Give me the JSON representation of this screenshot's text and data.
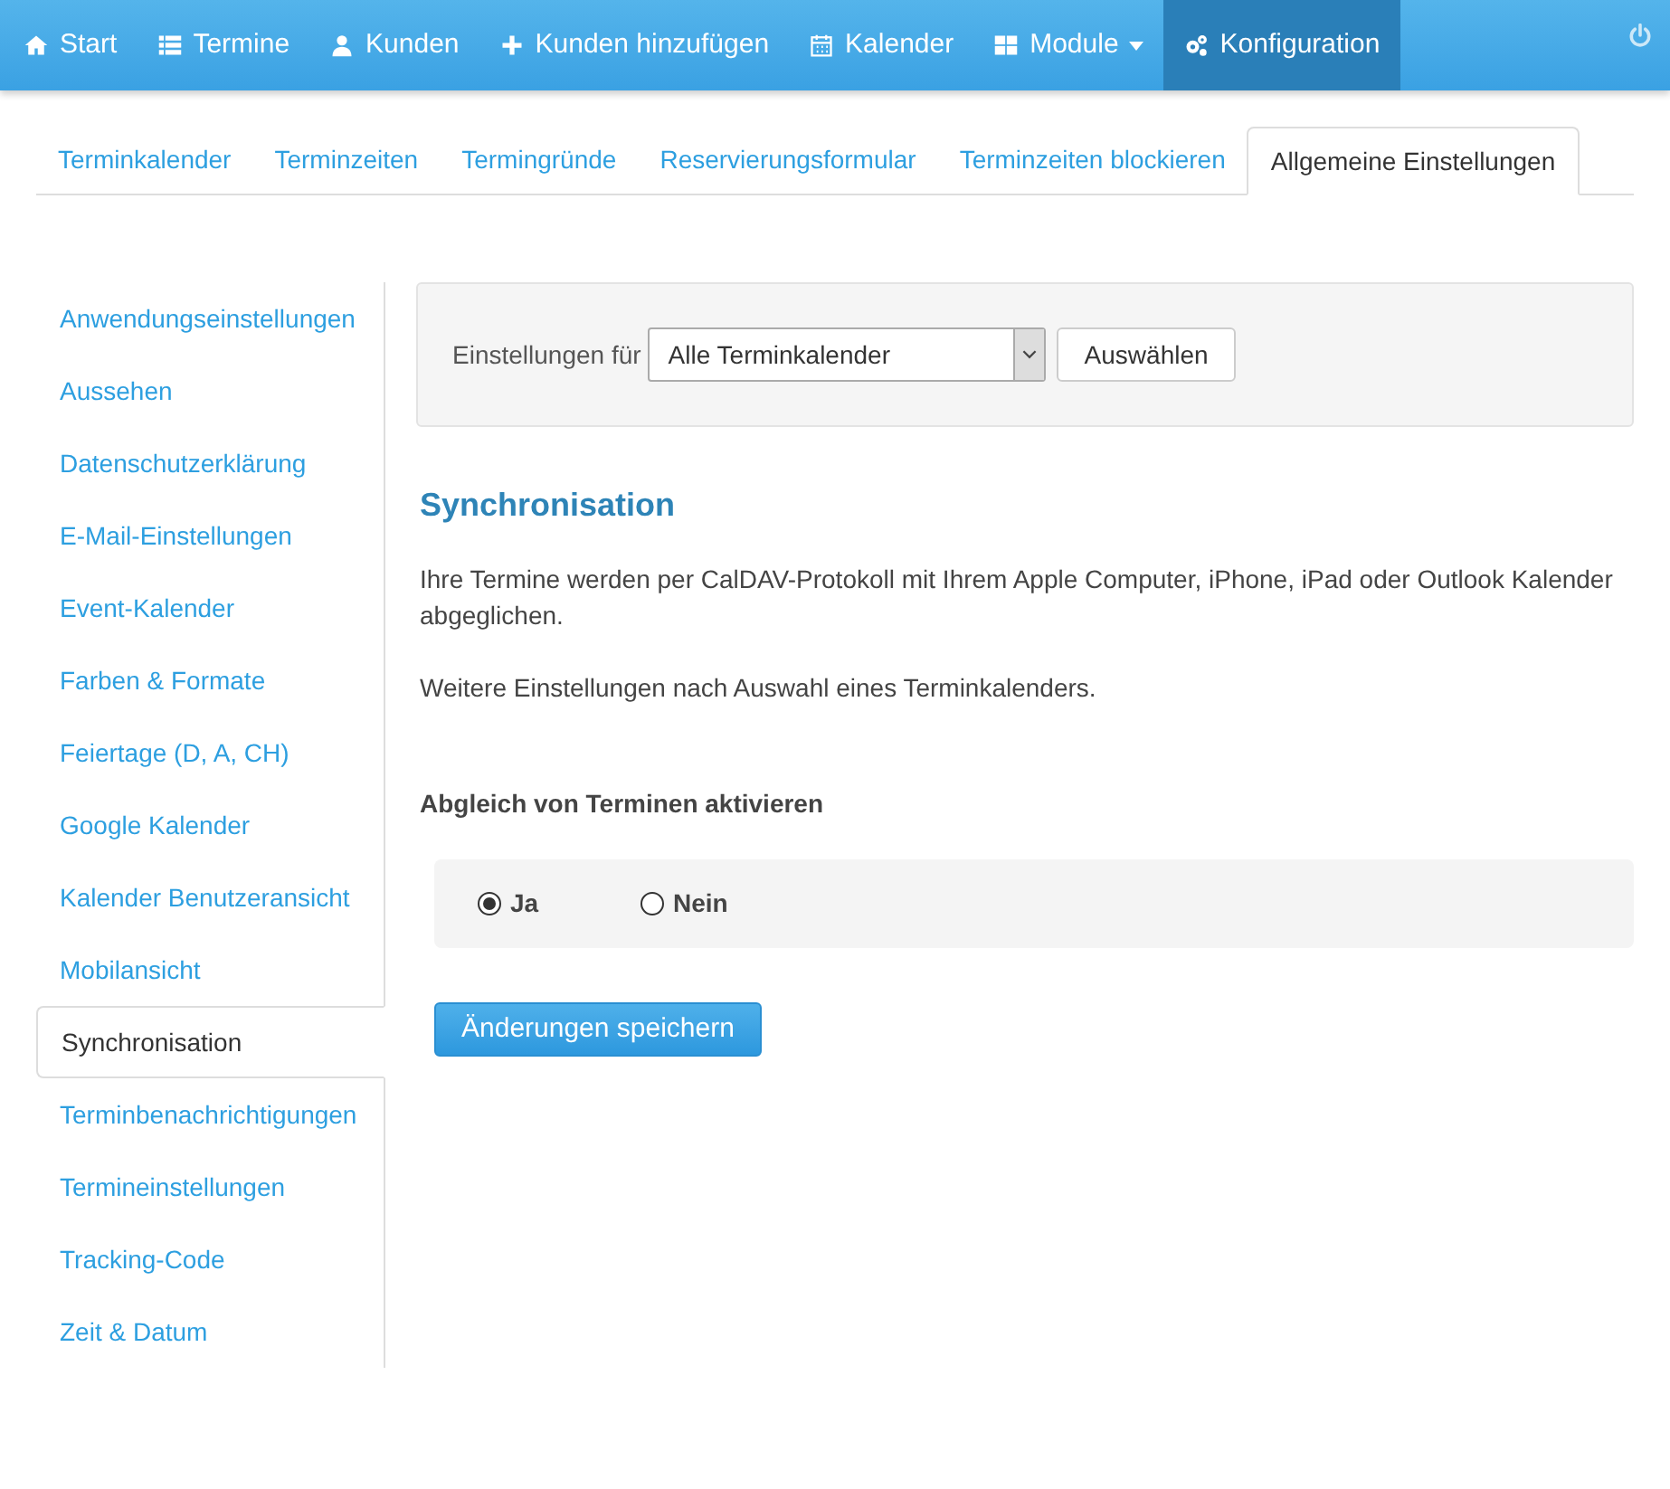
{
  "navbar": {
    "items": [
      {
        "label": "Start",
        "selected": false
      },
      {
        "label": "Termine",
        "selected": false
      },
      {
        "label": "Kunden",
        "selected": false
      },
      {
        "label": "Kunden hinzufügen",
        "selected": false
      },
      {
        "label": "Kalender",
        "selected": false
      },
      {
        "label": "Module",
        "selected": false,
        "dropdown": true
      },
      {
        "label": "Konfiguration",
        "selected": true
      }
    ]
  },
  "tabs": [
    {
      "label": "Terminkalender",
      "selected": false
    },
    {
      "label": "Terminzeiten",
      "selected": false
    },
    {
      "label": "Termingründe",
      "selected": false
    },
    {
      "label": "Reservierungsformular",
      "selected": false
    },
    {
      "label": "Terminzeiten blockieren",
      "selected": false
    },
    {
      "label": "Allgemeine Einstellungen",
      "selected": true
    }
  ],
  "sidebar": {
    "items": [
      {
        "label": "Anwendungseinstellungen",
        "selected": false
      },
      {
        "label": "Aussehen",
        "selected": false
      },
      {
        "label": "Datenschutzerklärung",
        "selected": false
      },
      {
        "label": "E-Mail-Einstellungen",
        "selected": false
      },
      {
        "label": "Event-Kalender",
        "selected": false
      },
      {
        "label": "Farben & Formate",
        "selected": false
      },
      {
        "label": "Feiertage (D, A, CH)",
        "selected": false
      },
      {
        "label": "Google Kalender",
        "selected": false
      },
      {
        "label": "Kalender Benutzeransicht",
        "selected": false
      },
      {
        "label": "Mobilansicht",
        "selected": false
      },
      {
        "label": "Synchronisation",
        "selected": true
      },
      {
        "label": "Terminbenachrichtigungen",
        "selected": false
      },
      {
        "label": "Termineinstellungen",
        "selected": false
      },
      {
        "label": "Tracking-Code",
        "selected": false
      },
      {
        "label": "Zeit & Datum",
        "selected": false
      }
    ]
  },
  "filter": {
    "label": "Einstellungen für",
    "value": "Alle Terminkalender",
    "button": "Auswählen"
  },
  "section": {
    "title": "Synchronisation",
    "paragraphs": [
      "Ihre Termine werden per CalDAV-Protokoll mit Ihrem Apple Computer, iPhone, iPad oder Outlook Kalender abgeglichen.",
      "Weitere Einstellungen nach Auswahl eines Terminkalenders."
    ]
  },
  "sync": {
    "label": "Abgleich von Terminen aktivieren",
    "options": [
      {
        "label": "Ja",
        "selected": true
      },
      {
        "label": "Nein",
        "selected": false
      }
    ]
  },
  "save_button": "Änderungen speichern"
}
